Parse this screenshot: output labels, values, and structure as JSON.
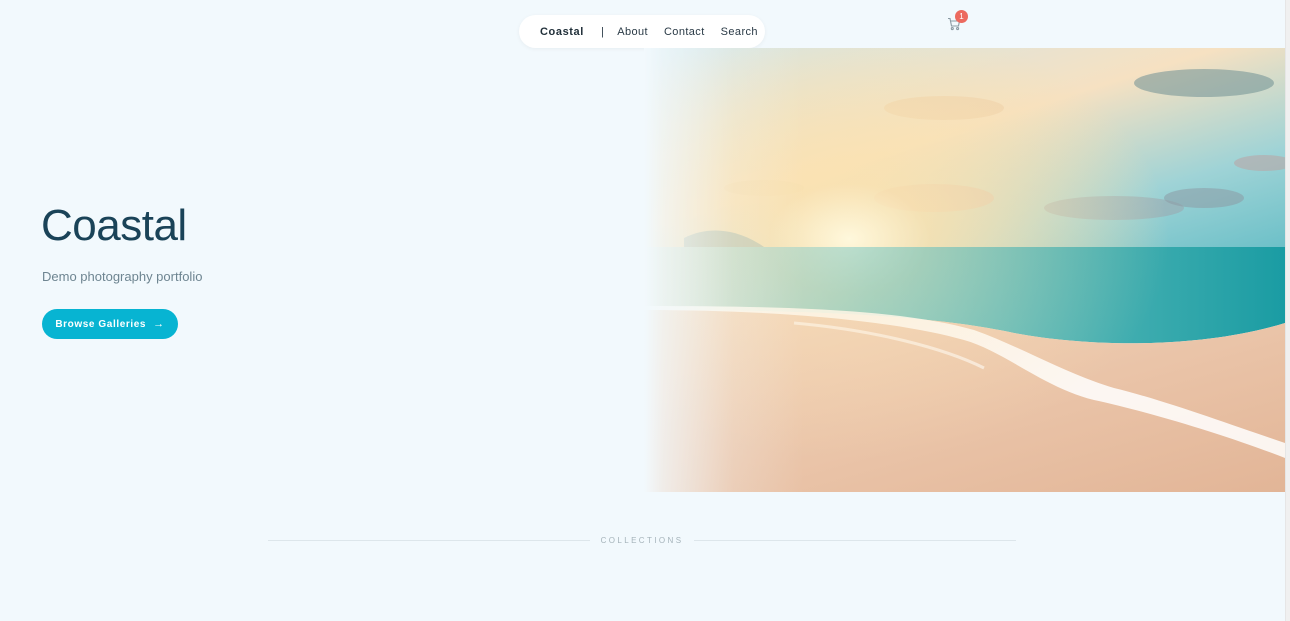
{
  "nav": {
    "brand": "Coastal",
    "separator": "|",
    "links": [
      "About",
      "Contact",
      "Search"
    ]
  },
  "cart": {
    "icon": "cart-icon",
    "count": "1"
  },
  "hero": {
    "title": "Coastal",
    "subtitle": "Demo photography portfolio",
    "button_label": "Browse Galleries",
    "button_icon": "arrow-right-icon",
    "image": "beach-sunset-photo"
  },
  "collections": {
    "label": "COLLECTIONS"
  },
  "colors": {
    "background": "#f2f9fd",
    "accent": "#07b4d2",
    "title": "#1a4358",
    "badge": "#ec6a5f"
  }
}
